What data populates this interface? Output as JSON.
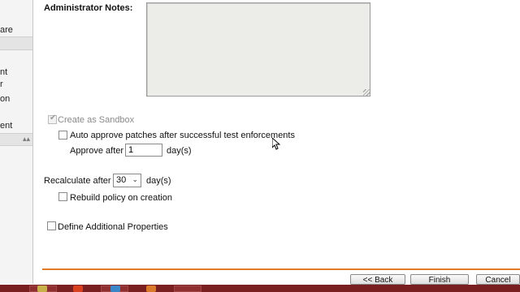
{
  "sidebar": {
    "items": [
      "are",
      "nt",
      "r",
      "on",
      "ent"
    ]
  },
  "form": {
    "admin_notes_label": "Administrator Notes:",
    "admin_notes_value": "",
    "create_sandbox_label": "Create as Sandbox",
    "create_sandbox_checked": true,
    "auto_approve_label": "Auto approve patches after successful test enforcements",
    "approve_after_label": "Approve after",
    "approve_after_value": "1",
    "approve_after_unit": "day(s)",
    "recalculate_label": "Recalculate after",
    "recalculate_value": "30",
    "recalculate_unit": "day(s)",
    "rebuild_policy_label": "Rebuild policy on creation",
    "define_props_label": "Define Additional Properties"
  },
  "footer": {
    "back_label": "<< Back",
    "finish_label": "Finish",
    "cancel_label": "Cancel"
  },
  "colors": {
    "accent_line": "#e07b2a",
    "taskbar": "#7a1f1f"
  }
}
